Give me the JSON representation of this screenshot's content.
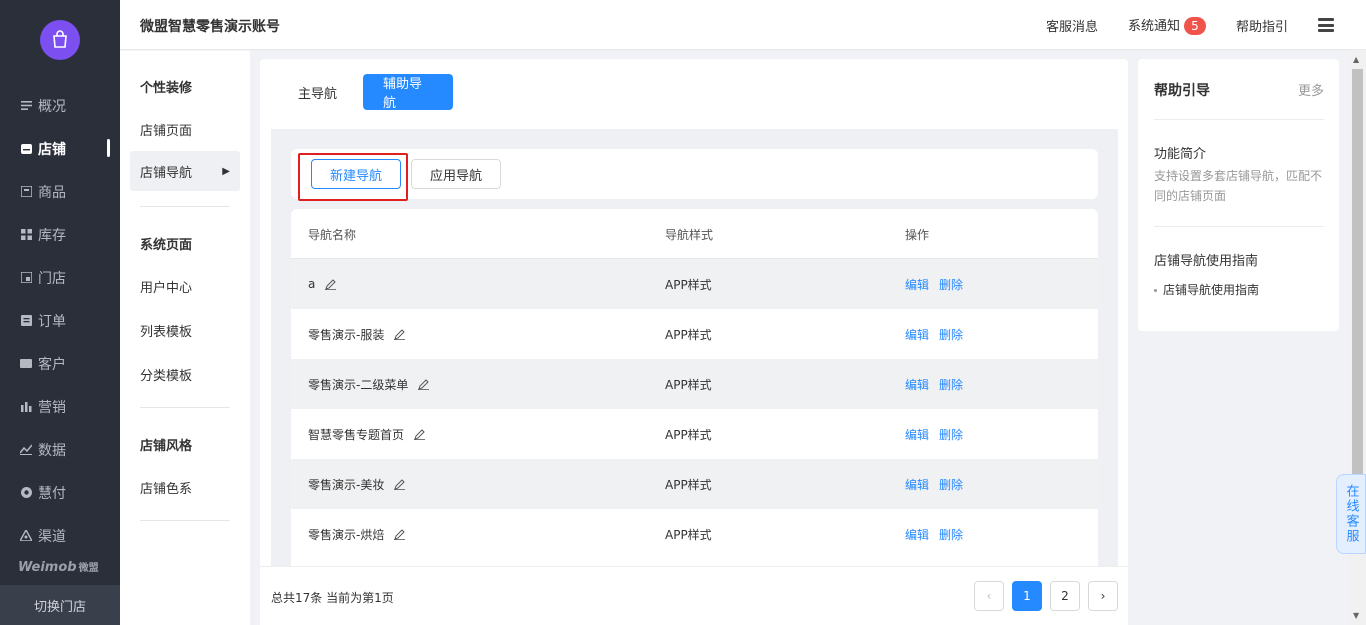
{
  "sidebar": {
    "items": [
      {
        "label": "概况",
        "icon": "list-icon"
      },
      {
        "label": "店铺",
        "icon": "store-icon",
        "active": true
      },
      {
        "label": "商品",
        "icon": "goods-icon"
      },
      {
        "label": "库存",
        "icon": "grid-icon"
      },
      {
        "label": "门店",
        "icon": "shop-icon"
      },
      {
        "label": "订单",
        "icon": "order-icon"
      },
      {
        "label": "客户",
        "icon": "vip-icon"
      },
      {
        "label": "营销",
        "icon": "bar-icon"
      },
      {
        "label": "数据",
        "icon": "trend-icon"
      },
      {
        "label": "慧付",
        "icon": "coin-icon"
      },
      {
        "label": "渠道",
        "icon": "channel-icon"
      }
    ],
    "brand": "Weimob",
    "brand_cn": "微盟",
    "switch_store": "切换门店"
  },
  "header": {
    "account": "微盟智慧零售演示账号",
    "service_msg": "客服消息",
    "notice": "系统通知",
    "notice_count": "5",
    "help": "帮助指引"
  },
  "subnav": {
    "group1": "个性装修",
    "store_page": "店铺页面",
    "store_nav": "店铺导航",
    "group2": "系统页面",
    "user_center": "用户中心",
    "list_tpl": "列表模板",
    "cat_tpl": "分类模板",
    "group3": "店铺风格",
    "color": "店铺色系"
  },
  "tabs": {
    "main": "主导航",
    "aux": "辅助导航"
  },
  "buttons": {
    "new": "新建导航",
    "apply": "应用导航"
  },
  "table": {
    "headers": [
      "导航名称",
      "导航样式",
      "操作"
    ],
    "edit": "编辑",
    "delete": "删除",
    "rows": [
      {
        "name": "a",
        "style": "APP样式"
      },
      {
        "name": "零售演示-服装",
        "style": "APP样式"
      },
      {
        "name": "零售演示-二级菜单",
        "style": "APP样式"
      },
      {
        "name": "智慧零售专题首页",
        "style": "APP样式"
      },
      {
        "name": "零售演示-美妆",
        "style": "APP样式"
      },
      {
        "name": "零售演示-烘焙",
        "style": "APP样式"
      }
    ]
  },
  "footer": {
    "total": "总共17条 当前为第1页",
    "page1": "1",
    "page2": "2"
  },
  "help": {
    "title": "帮助引导",
    "more": "更多",
    "intro_h": "功能简介",
    "intro": "支持设置多套店铺导航，匹配不同的店铺页面",
    "guide_h": "店铺导航使用指南",
    "guide_link": "店铺导航使用指南"
  },
  "online_service": "在线客服",
  "colors": {
    "accent": "#2589ff",
    "sidebar": "#2b2f3a",
    "highlight": "#e02020"
  }
}
